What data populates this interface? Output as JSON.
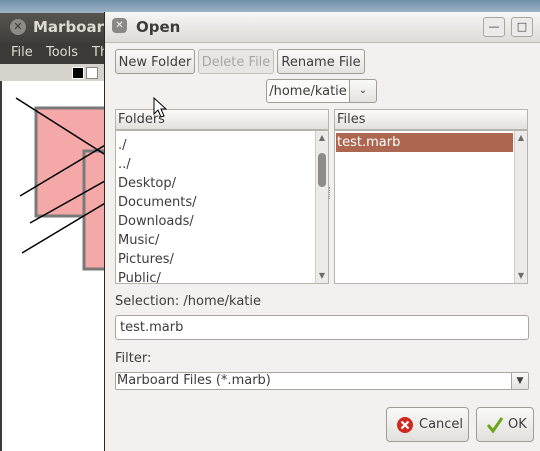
{
  "background_app": {
    "title": "Marboard",
    "menu": [
      "File",
      "Tools",
      "Th"
    ],
    "close_glyph": "✕"
  },
  "dialog": {
    "title": "Open",
    "close_glyph": "✕",
    "minimize_glyph": "—",
    "maximize_glyph": "□"
  },
  "toolbar": {
    "new_folder": "New Folder",
    "delete_file": "Delete File",
    "rename_file": "Rename File"
  },
  "path": {
    "current": "/home/katie",
    "dropdown_glyph": "⌄"
  },
  "folders": {
    "header": "Folders",
    "items": [
      "./",
      "../",
      "Desktop/",
      "Documents/",
      "Downloads/",
      "Music/",
      "Pictures/",
      "Public/"
    ]
  },
  "files": {
    "header": "Files",
    "items": [
      "test.marb"
    ],
    "selected_index": 0
  },
  "selection": {
    "label": "Selection: /home/katie",
    "value": "test.marb"
  },
  "filter": {
    "label": "Filter:",
    "selected": "Marboard Files (*.marb)"
  },
  "actions": {
    "cancel": "Cancel",
    "ok": "OK"
  },
  "colors": {
    "selection_bg": "#ad6750",
    "dialog_bg": "#f2f1f0",
    "cancel_icon": "#d0281f",
    "ok_icon": "#6aa51c",
    "shape_fill": "#f4a8a8"
  },
  "icons": {
    "scroll_up": "▲",
    "scroll_down": "▼",
    "combo_arrow": "▼"
  }
}
